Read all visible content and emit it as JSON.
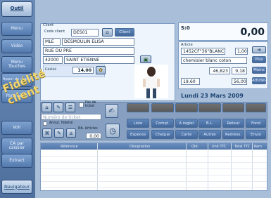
{
  "sidebar": {
    "items": [
      {
        "label": "Outil"
      },
      {
        "label": "Menu"
      },
      {
        "label": "Vidéo"
      },
      {
        "label": "Menu\nTouches"
      },
      {
        "label": "Appel de menu"
      },
      {
        "label": "Paramètre"
      },
      {
        "label": "Voir"
      },
      {
        "label": "CA par\ncaissier"
      },
      {
        "label": "Extract"
      },
      {
        "label": "Navigateur"
      }
    ]
  },
  "client": {
    "section": "Client",
    "code_label": "Code client",
    "code_value": "DES01",
    "client_button": "Client",
    "title": "MLE",
    "name": "DESMOULIN ELISA",
    "street": "RUE DU PRE",
    "postal": "42000",
    "city": "SAINT ETIENNE",
    "fidelity_label": "Fidélité",
    "fidelity_value": "14,00",
    "banner": "Fidélité client"
  },
  "total": {
    "label": "S:0",
    "value": "0,00"
  },
  "article": {
    "section": "Article",
    "code": "1452CF\"36\"BLANC",
    "qty": "1,00",
    "desc": "chemisier blanc coton",
    "val1": "46,823",
    "val2": "9,18",
    "val3": "19,60",
    "val4": "56,00",
    "buttons": [
      "Plus",
      "Moins",
      "Articles"
    ]
  },
  "date": "Lundi 23 Mars 2009",
  "ticket": {
    "pas_de_ticket": "Pas de\nticket",
    "placeholder": "Numéro de ticket",
    "annul_label": "Annul. fidelité",
    "nb_articles_label": "Nb. Articles",
    "nb_articles_value": "0,00"
  },
  "actions": {
    "row1": [
      "Liste",
      "Compt.",
      "A regler",
      "B.L.",
      "Retour",
      "Fond"
    ],
    "row2": [
      "Especes",
      "Cheque",
      "Carte",
      "Autres",
      "Redress.",
      "Envoi"
    ]
  },
  "table": {
    "headers": [
      "Référence",
      "Désignation",
      "Qté",
      "Unit.TTC",
      "Total TTC",
      "Rem"
    ]
  }
}
